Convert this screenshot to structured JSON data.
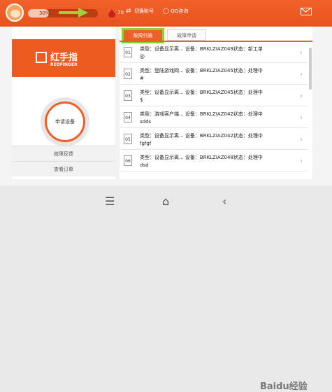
{
  "topbar": {
    "progress_text": "30%",
    "progress_fraction": 0.3,
    "hp_value": "70",
    "switch_label": "切换账号",
    "qq_label": "QQ咨询"
  },
  "sidebar": {
    "brand": "红手指",
    "brand_en": "REDFINGER",
    "apply_label": "申请设备",
    "report_label": "故障反馈",
    "orders_label": "查看订单"
  },
  "tabs": [
    {
      "label": "故障列表"
    },
    {
      "label": "故障申请"
    }
  ],
  "faults": [
    {
      "num": "01",
      "line1": "类型：设备显示离...   设备：BRKLZIAZ049状态：新工单",
      "desc": "@"
    },
    {
      "num": "02",
      "line1": "类型：登陆游戏网...   设备：BRKLZIAZ045状态：处理中",
      "desc": "#"
    },
    {
      "num": "03",
      "line1": "类型：设备显示离...   设备：BRKLZIAZ045状态：处理中",
      "desc": "$"
    },
    {
      "num": "04",
      "line1": "类型：游戏客户端...   设备：BRKLZIAZ042状态：处理中",
      "desc": "sdds"
    },
    {
      "num": "05",
      "line1": "类型：设备显示离...   设备：BRKLZIAZ042状态：处理中",
      "desc": "fgfgf"
    },
    {
      "num": "06",
      "line1": "类型：设备显示离...   设备：BRKLZIAZ048状态：处理中",
      "desc": "dsd"
    }
  ],
  "watermark": "Baidu经验"
}
